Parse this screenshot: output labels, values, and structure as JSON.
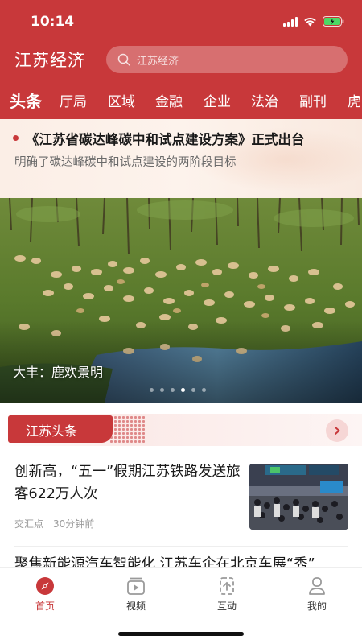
{
  "status_bar": {
    "time": "10:14"
  },
  "header": {
    "app_title": "江苏经济",
    "search_placeholder": "江苏经济"
  },
  "nav_tabs": [
    "头条",
    "厅局",
    "区域",
    "金融",
    "企业",
    "法治",
    "副刊",
    "虎"
  ],
  "headline": {
    "title": "《江苏省碳达峰碳中和试点建设方案》正式出台",
    "subtitle": "明确了碳达峰碳中和试点建设的两阶段目标"
  },
  "hero": {
    "caption": "大丰：鹿欢景明",
    "carousel_count": 6,
    "carousel_active": 4
  },
  "section": {
    "title": "江苏头条"
  },
  "news": [
    {
      "title": "创新高，“五一”假期江苏铁路发送旅客622万人次",
      "source": "交汇点",
      "time": "30分钟前"
    },
    {
      "title": "聚焦新能源汽车智能化 江苏车企在北京车展“秀”"
    }
  ],
  "bottom_nav": [
    {
      "label": "首页",
      "icon": "compass-icon",
      "active": true
    },
    {
      "label": "视频",
      "icon": "video-icon",
      "active": false
    },
    {
      "label": "互动",
      "icon": "interact-icon",
      "active": false
    },
    {
      "label": "我的",
      "icon": "profile-icon",
      "active": false
    }
  ],
  "colors": {
    "brand": "#c8383a",
    "text": "#1a1a1a",
    "muted": "#9a9a9a"
  }
}
